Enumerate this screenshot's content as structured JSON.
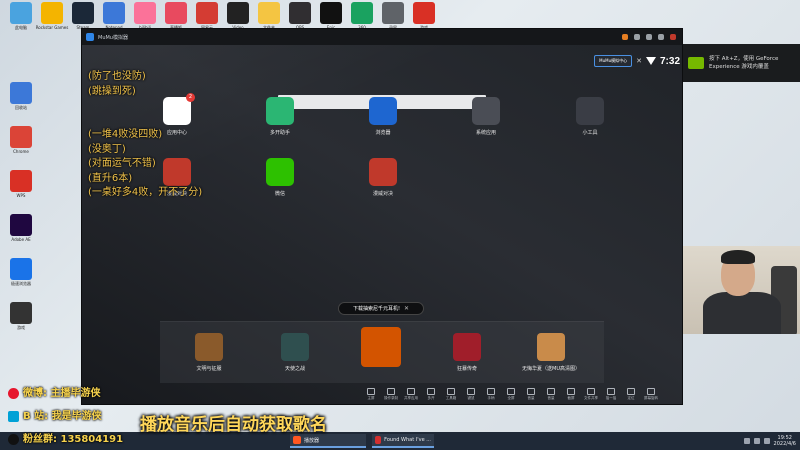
{
  "desktop": {
    "icons": [
      {
        "label": "此电脑",
        "color": "#4aa3df"
      },
      {
        "label": "Rockstar Games",
        "color": "#f4b400"
      },
      {
        "label": "Steam",
        "color": "#1b2838"
      },
      {
        "label": "Notepad",
        "color": "#3c78d8"
      },
      {
        "label": "bilibili",
        "color": "#fb7299"
      },
      {
        "label": "直播姬",
        "color": "#e84a5f"
      },
      {
        "label": "网易云",
        "color": "#d43c33"
      },
      {
        "label": "Video",
        "color": "#222222"
      },
      {
        "label": "文件夹",
        "color": "#f4c542"
      },
      {
        "label": "OBS",
        "color": "#302e31"
      },
      {
        "label": "Epic",
        "color": "#111111"
      },
      {
        "label": "360",
        "color": "#1aa260"
      },
      {
        "label": "录屏",
        "color": "#5f6368"
      },
      {
        "label": "游戏",
        "color": "#d93025"
      }
    ],
    "left_column": [
      {
        "label": "回收站",
        "color": "#3c78d8"
      },
      {
        "label": "Chrome",
        "color": "#db4437"
      },
      {
        "label": "WPS",
        "color": "#d93025"
      },
      {
        "label": "Adobe AE",
        "color": "#1f0740"
      },
      {
        "label": "极速浏览器",
        "color": "#1a73e8"
      },
      {
        "label": "游戏",
        "color": "#333333"
      }
    ]
  },
  "emulator": {
    "title": "MuMu模拟器",
    "status_box": "MuMu模拟中心",
    "close": "✕",
    "time": "7:32",
    "apps": [
      {
        "label": "应用中心",
        "color": "#ffffff",
        "badge": "2"
      },
      {
        "label": "多开助手",
        "color": "#2bb673",
        "dot": true
      },
      {
        "label": "浏览器",
        "color": "#1e66d0"
      },
      {
        "label": "系统应用",
        "color": "#4a4d55"
      },
      {
        "label": "小工具",
        "color": "#3a3d45"
      },
      {
        "label": "漫威对决",
        "color": "#c0392b"
      },
      {
        "label": "微信",
        "color": "#2dc100"
      },
      {
        "label": "漫威对决",
        "color": "#c0392b"
      }
    ],
    "ad_pill": {
      "text": "下载抽索尼千元耳机!",
      "close": "✕"
    },
    "dock": [
      {
        "label": "文明与征服",
        "color": "#8a5a2b"
      },
      {
        "label": "天使之战",
        "color": "#2f4f4f"
      },
      {
        "label": "",
        "color": "#d35400"
      },
      {
        "label": "狂暴传奇",
        "color": "#a01e2a"
      },
      {
        "label": "无悔华夏（送MU高清图）",
        "color": "#c98b4a"
      }
    ],
    "toolbar": [
      "主屏",
      "操作录制",
      "共享应用",
      "多开",
      "工具箱",
      "键鼠",
      "手柄",
      "全屏",
      "音量",
      "音量",
      "截屏",
      "文件共享",
      "摇一摇",
      "定位",
      "屏幕旋转"
    ]
  },
  "overlay": {
    "lines": [
      "(防了也没防)",
      "(跳操到死)",
      "",
      "",
      "(一堆4败没四败)",
      "(没奥丁)",
      "(对面运气不错)",
      "(直升6本)",
      "(一桌好多4败，开不了分)"
    ]
  },
  "nvidia": {
    "line1": "按下 Alt+Z，使用 GeForce",
    "line2": "Experience 游戏内覆盖"
  },
  "stream": {
    "weibo": "微博: 主播毕游侠",
    "bilibili": "B 站: 我是毕游侠",
    "qq": "粉丝群: 135804191",
    "music": "播放音乐后自动获取歌名"
  },
  "taskbar": {
    "tasks": [
      {
        "label": "播放器",
        "color": "#ff5722"
      },
      {
        "label": "Found What I've ...",
        "color": "#d32f2f"
      }
    ],
    "time": "19:52",
    "date": "2022/4/6"
  }
}
